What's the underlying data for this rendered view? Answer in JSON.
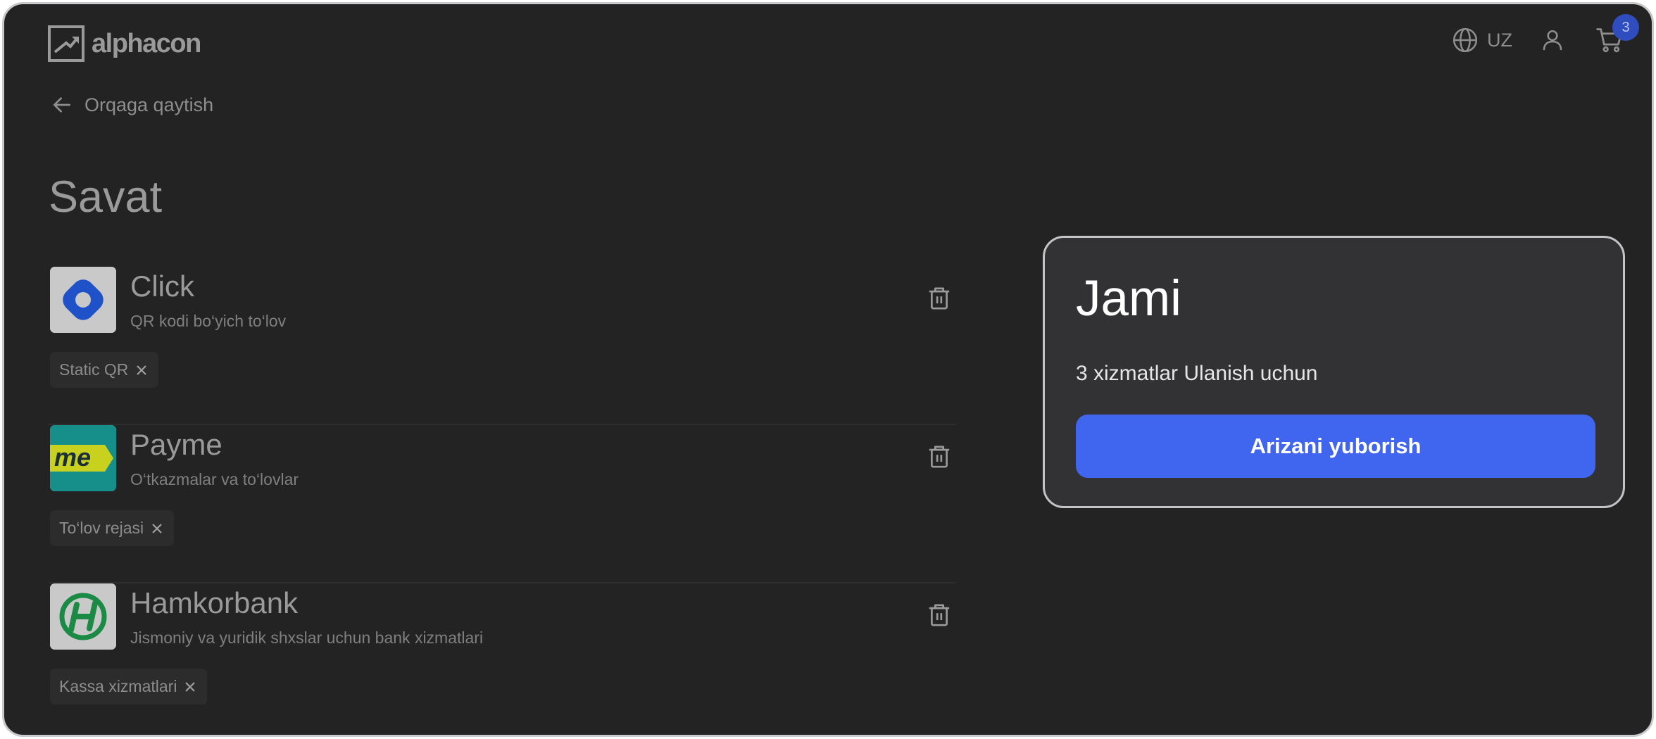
{
  "header": {
    "logo_text": "alphacon",
    "language": "UZ",
    "cart_count": "3",
    "icons": {
      "language": "globe-icon",
      "user": "user-icon",
      "cart": "cart-icon"
    }
  },
  "back_link": {
    "label": "Orqaga qaytish",
    "icon": "arrow-left-icon"
  },
  "page_title": "Savat",
  "cart_items": [
    {
      "name": "Click",
      "description": "QR kodi bo‘yich to‘lov",
      "tag": "Static QR",
      "logo_icon": "click-logo-icon",
      "delete_icon": "trash-icon"
    },
    {
      "name": "Payme",
      "description": "O‘tkazmalar va to‘lovlar",
      "tag": "To‘lov rejasi",
      "logo_icon": "payme-logo-icon",
      "delete_icon": "trash-icon"
    },
    {
      "name": "Hamkorbank",
      "description": "Jismoniy va yuridik shxslar uchun bank xizmatlari",
      "tag": "Kassa xizmatlari",
      "logo_icon": "hamkorbank-logo-icon",
      "delete_icon": "trash-icon"
    }
  ],
  "summary": {
    "title": "Jami",
    "text": "3 xizmatlar Ulanish uchun",
    "button_label": "Arizani yuborish"
  },
  "colors": {
    "background": "#232323",
    "card": "#323234",
    "accent": "#4065ee",
    "badge": "#2f4dbf"
  }
}
